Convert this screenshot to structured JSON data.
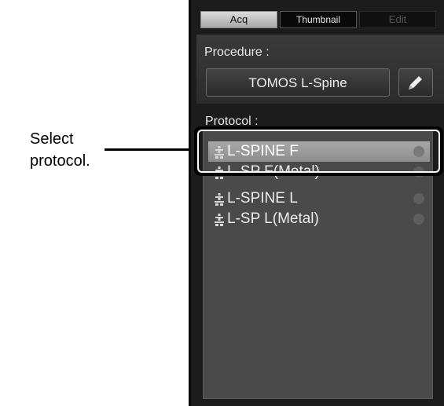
{
  "callout": {
    "text_line1": "Select",
    "text_line2": "protocol."
  },
  "tabs": [
    {
      "label": "Acq"
    },
    {
      "label": "Thumbnail"
    },
    {
      "label": "Edit"
    }
  ],
  "procedure": {
    "label": "Procedure :",
    "value": "TOMOS L-Spine",
    "edit_icon": "pencil-icon"
  },
  "protocol": {
    "label": "Protocol :",
    "items": [
      {
        "name": "L-SPINE F",
        "selected": true
      },
      {
        "name": "L-SP F(Metal)",
        "selected": false
      },
      {
        "name": "L-SPINE L",
        "selected": false
      },
      {
        "name": "L-SP L(Metal)",
        "selected": false
      }
    ],
    "item_icon": "spine-icon"
  },
  "colors": {
    "panel_bg": "#1c1c1c",
    "list_bg": "#4a4a4a",
    "selected_row": "#9a9a9a",
    "highlight_border": "#000000"
  }
}
